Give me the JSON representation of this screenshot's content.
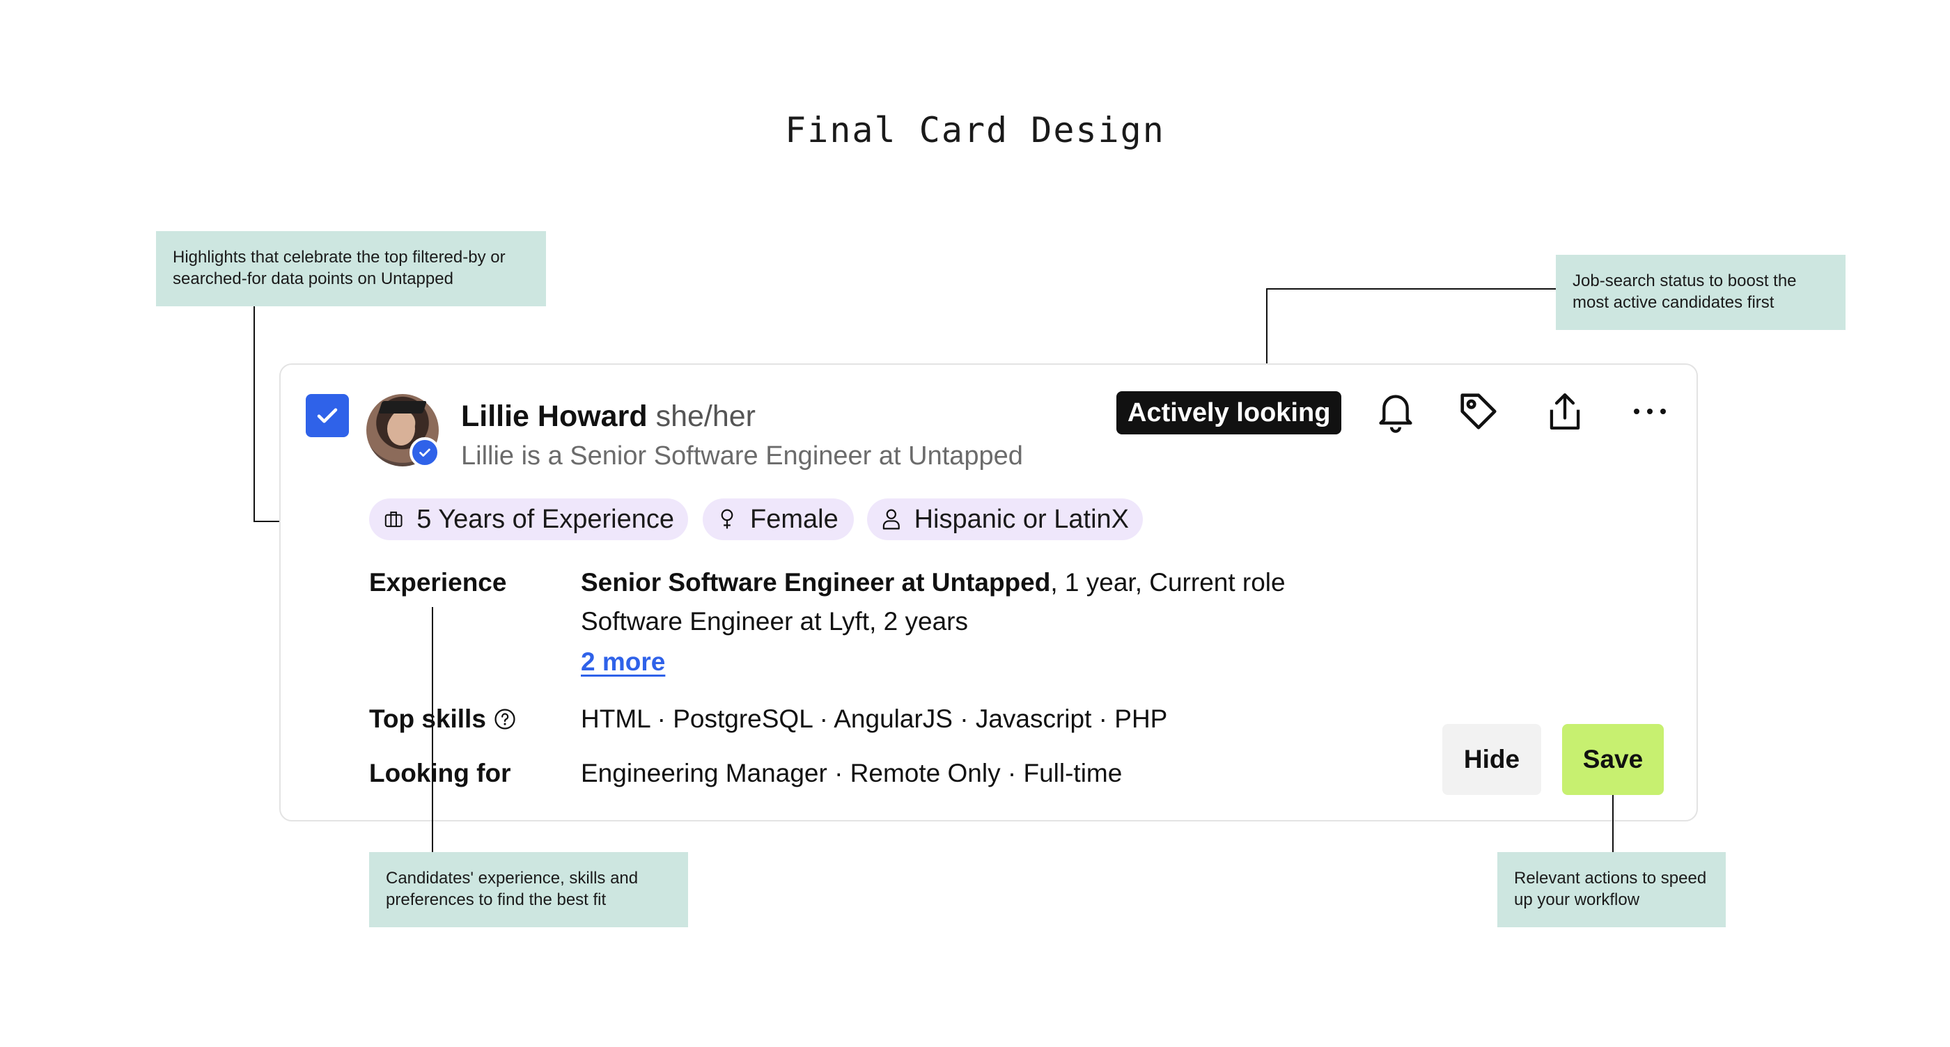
{
  "page_title": "Final Card Design",
  "annotations": {
    "highlights": "Highlights that celebrate the top filtered-by or searched-for data points on Untapped",
    "status": "Job-search status to boost the most active candidates first",
    "details": "Candidates' experience, skills and preferences to find the best fit",
    "actions": "Relevant actions to speed up your workflow"
  },
  "candidate": {
    "name": "Lillie Howard",
    "pronouns": "she/her",
    "headline": "Lillie is a Senior Software Engineer at Untapped",
    "status": "Actively looking"
  },
  "chips": [
    {
      "label": "5 Years of Experience",
      "icon": "briefcase-icon"
    },
    {
      "label": "Female",
      "icon": "female-icon"
    },
    {
      "label": "Hispanic or LatinX",
      "icon": "person-icon"
    }
  ],
  "details": {
    "experience_label": "Experience",
    "experience": [
      {
        "role": "Senior Software Engineer at Untapped",
        "meta": ", 1 year, Current role"
      },
      {
        "role": "Software Engineer at Lyft, 2 years",
        "meta": ""
      }
    ],
    "more_link": "2 more",
    "skills_label": "Top skills",
    "skills": "HTML · PostgreSQL · AngularJS · Javascript · PHP",
    "looking_label": "Looking for",
    "looking": "Engineering Manager · Remote Only · Full-time"
  },
  "buttons": {
    "hide": "Hide",
    "save": "Save"
  },
  "colors": {
    "accent": "#2f62e9",
    "status_bg": "#111111",
    "chip_bg": "#efe7fb",
    "save_bg": "#c7f070",
    "hide_bg": "#f2f2f2",
    "note_bg": "#cde6e0"
  }
}
